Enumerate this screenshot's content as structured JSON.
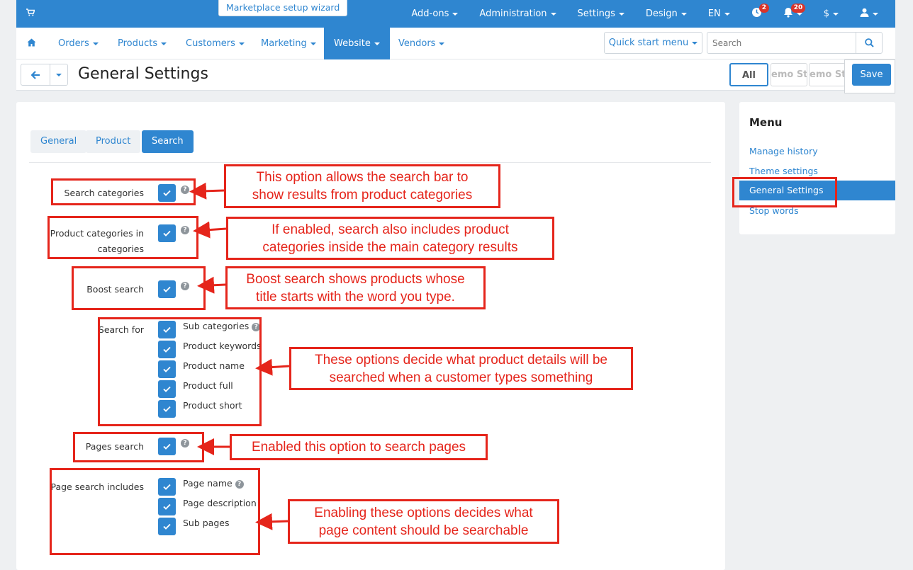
{
  "topbar": {
    "wizard_label": "Marketplace setup wizard",
    "items": [
      {
        "label": "Add-ons"
      },
      {
        "label": "Administration"
      },
      {
        "label": "Settings"
      },
      {
        "label": "Design"
      },
      {
        "label": "EN"
      }
    ],
    "orders_badge": "2",
    "notifications_badge": "20",
    "currency": "$"
  },
  "nav": {
    "items": [
      "Orders",
      "Products",
      "Customers",
      "Marketing",
      "Website",
      "Vendors"
    ],
    "active": "Website",
    "quick_start": "Quick start menu",
    "search_placeholder": "Search"
  },
  "titlebar": {
    "title": "General Settings",
    "filters": [
      "All",
      "emo Sto",
      "emo Sto"
    ],
    "save_label": "Save"
  },
  "tabs": [
    "General",
    "Product",
    "Search"
  ],
  "active_tab": "Search",
  "settings": {
    "search_categories": "Search categories",
    "product_categories_l1": "Product categories in",
    "product_categories_l2": "categories",
    "boost_search": "Boost search",
    "search_for": "Search for",
    "search_for_options": [
      "Sub categories",
      "Product keywords",
      "Product name",
      "Product full",
      "Product short"
    ],
    "pages_search": "Pages search",
    "page_search_includes": "Page search includes",
    "page_search_options": [
      "Page name",
      "Page description",
      "Sub pages"
    ]
  },
  "sidebar": {
    "title": "Menu",
    "items": [
      "Manage history",
      "Theme settings",
      "General Settings",
      "Stop words"
    ],
    "active": "General Settings"
  },
  "annotations": {
    "n1_l1": "This option allows the search bar to",
    "n1_l2": "show results from product categories",
    "n2_l1": "If enabled, search also includes product",
    "n2_l2": "categories inside the main category results",
    "n3_l1": "Boost search shows products whose",
    "n3_l2": "title starts with the word you type.",
    "n4_l1": "These options decide what product details will be",
    "n4_l2": "searched when a customer types something",
    "n5": "Enabled this option to search pages",
    "n6_l1": "Enabling these options decides what",
    "n6_l2": "page content should be searchable"
  },
  "colors": {
    "primary": "#2f86d0",
    "annotation": "#e5251b",
    "badge": "#d9342b"
  }
}
